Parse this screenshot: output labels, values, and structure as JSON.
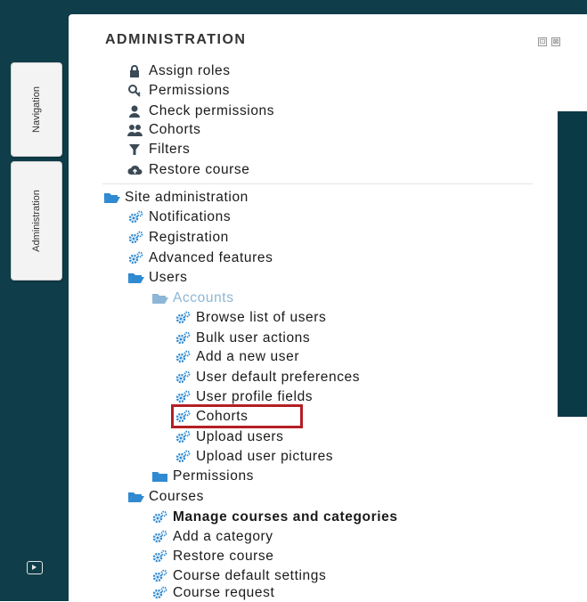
{
  "block": {
    "title": "ADMINISTRATION",
    "ctrl_a": "⊡",
    "ctrl_b": "⊠"
  },
  "side_tabs": {
    "navigation": "Navigation",
    "administration": "Administration"
  },
  "course_admin": [
    {
      "label": "Assign roles",
      "icon": "lock-icon"
    },
    {
      "label": "Permissions",
      "icon": "key-icon"
    },
    {
      "label": "Check permissions",
      "icon": "user-icon"
    },
    {
      "label": "Cohorts",
      "icon": "users-icon"
    },
    {
      "label": "Filters",
      "icon": "filter-icon"
    },
    {
      "label": "Restore course",
      "icon": "cloud-upload-icon"
    }
  ],
  "site_admin": {
    "label": "Site administration",
    "items": [
      {
        "label": "Notifications",
        "icon": "gears-icon"
      },
      {
        "label": "Registration",
        "icon": "gears-icon"
      },
      {
        "label": "Advanced features",
        "icon": "gears-icon"
      }
    ],
    "users": {
      "label": "Users",
      "accounts": {
        "label": "Accounts",
        "items": [
          {
            "label": "Browse list of users",
            "icon": "gears-icon"
          },
          {
            "label": "Bulk user actions",
            "icon": "gears-icon"
          },
          {
            "label": "Add a new user",
            "icon": "gears-icon"
          },
          {
            "label": "User default preferences",
            "icon": "gears-icon"
          },
          {
            "label": "User profile fields",
            "icon": "gears-icon"
          },
          {
            "label": "Cohorts",
            "icon": "gears-icon",
            "highlighted": true
          },
          {
            "label": "Upload users",
            "icon": "gears-icon"
          },
          {
            "label": "Upload user pictures",
            "icon": "gears-icon"
          }
        ]
      },
      "permissions": "Permissions"
    },
    "courses": {
      "label": "Courses",
      "items": [
        {
          "label": "Manage courses and categories",
          "icon": "gears-icon",
          "bold": true
        },
        {
          "label": "Add a category",
          "icon": "gears-icon"
        },
        {
          "label": "Restore course",
          "icon": "gears-icon"
        },
        {
          "label": "Course default settings",
          "icon": "gears-icon"
        },
        {
          "label": "Course request",
          "icon": "gears-icon"
        }
      ]
    }
  },
  "colors": {
    "dark_teal": "#0f3d4a",
    "icon_blue": "#2f8ad1",
    "icon_dark": "#3b4a55",
    "highlight_red": "#b31f24",
    "accounts_muted": "#8bb6d6"
  }
}
